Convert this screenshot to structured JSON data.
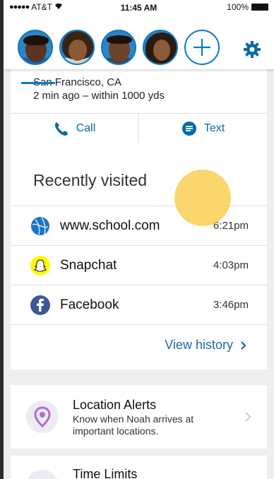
{
  "status_bar": {
    "carrier": "AT&T",
    "signal_dots": "●●●●●",
    "time": "11:45 AM",
    "battery": "100%"
  },
  "header": {
    "avatars": [
      {
        "name": "child-1"
      },
      {
        "name": "child-2"
      },
      {
        "name": "child-3"
      },
      {
        "name": "child-4"
      }
    ],
    "add_label": "+",
    "settings_icon": "gear-icon"
  },
  "location": {
    "city": "San Francisco, CA",
    "time_accuracy": "2 min ago – within 1000 yds",
    "call_label": "Call",
    "text_label": "Text"
  },
  "recently_visited": {
    "title": "Recently visited",
    "items": [
      {
        "name": "www.school.com",
        "time": "6:21pm",
        "icon": "globe-icon"
      },
      {
        "name": "Snapchat",
        "time": "4:03pm",
        "icon": "snapchat-icon"
      },
      {
        "name": "Facebook",
        "time": "3:46pm",
        "icon": "facebook-icon"
      }
    ],
    "view_history_label": "View history"
  },
  "location_alerts": {
    "title": "Location Alerts",
    "description": "Know when Noah arrives at important locations."
  },
  "time_limits": {
    "title": "Time Limits"
  },
  "colors": {
    "accent": "#0a7ac2",
    "link": "#1a6ba2",
    "tap_highlight": "#fac83c"
  }
}
